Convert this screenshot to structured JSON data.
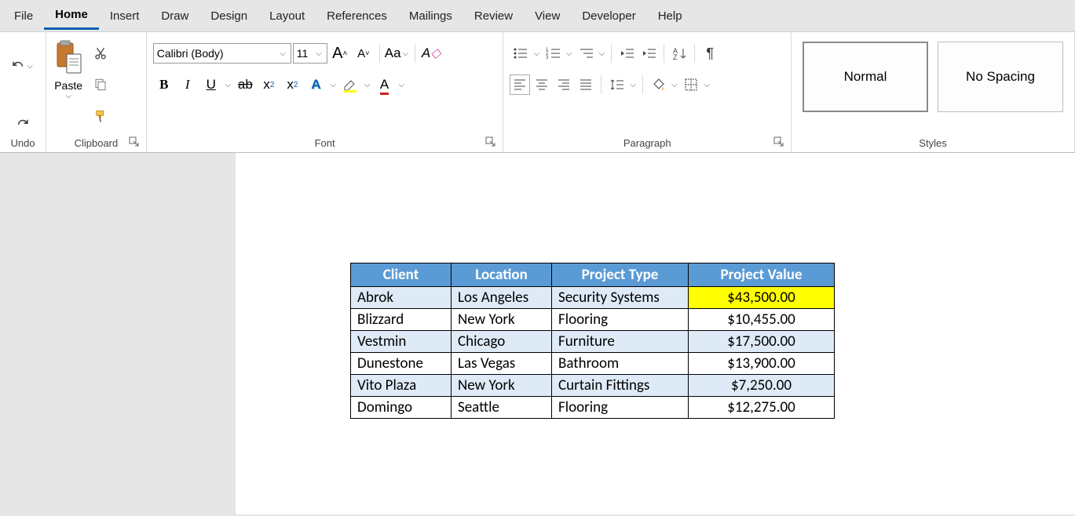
{
  "tabs": [
    "File",
    "Home",
    "Insert",
    "Draw",
    "Design",
    "Layout",
    "References",
    "Mailings",
    "Review",
    "View",
    "Developer",
    "Help"
  ],
  "active_tab": "Home",
  "groups": {
    "undo": "Undo",
    "clipboard": "Clipboard",
    "font": "Font",
    "paragraph": "Paragraph",
    "styles": "Styles"
  },
  "clipboard": {
    "paste": "Paste"
  },
  "font": {
    "name": "Calibri (Body)",
    "size": "11",
    "case_label": "Aa"
  },
  "styles": {
    "normal": "Normal",
    "nospacing": "No Spacing"
  },
  "table": {
    "headers": [
      "Client",
      "Location",
      "Project Type",
      "Project Value"
    ],
    "rows": [
      {
        "client": "Abrok",
        "location": "Los Angeles",
        "type": "Security Systems",
        "value": "$43,500.00",
        "alt": true,
        "highlight": true
      },
      {
        "client": "Blizzard",
        "location": "New York",
        "type": "Flooring",
        "value": "$10,455.00",
        "alt": false,
        "highlight": false
      },
      {
        "client": "Vestmin",
        "location": "Chicago",
        "type": "Furniture",
        "value": "$17,500.00",
        "alt": true,
        "highlight": false
      },
      {
        "client": "Dunestone",
        "location": "Las Vegas",
        "type": "Bathroom",
        "value": "$13,900.00",
        "alt": false,
        "highlight": false
      },
      {
        "client": "Vito Plaza",
        "location": "New York",
        "type": "Curtain Fittings",
        "value": "$7,250.00",
        "alt": true,
        "highlight": false
      },
      {
        "client": "Domingo",
        "location": "Seattle",
        "type": "Flooring",
        "value": "$12,275.00",
        "alt": false,
        "highlight": false
      }
    ]
  },
  "chart_data": {
    "type": "table",
    "title": "",
    "columns": [
      "Client",
      "Location",
      "Project Type",
      "Project Value"
    ],
    "rows": [
      [
        "Abrok",
        "Los Angeles",
        "Security Systems",
        43500.0
      ],
      [
        "Blizzard",
        "New York",
        "Flooring",
        10455.0
      ],
      [
        "Vestmin",
        "Chicago",
        "Furniture",
        17500.0
      ],
      [
        "Dunestone",
        "Las Vegas",
        "Bathroom",
        13900.0
      ],
      [
        "Vito Plaza",
        "New York",
        "Curtain Fittings",
        7250.0
      ],
      [
        "Domingo",
        "Seattle",
        "Flooring",
        12275.0
      ]
    ]
  }
}
